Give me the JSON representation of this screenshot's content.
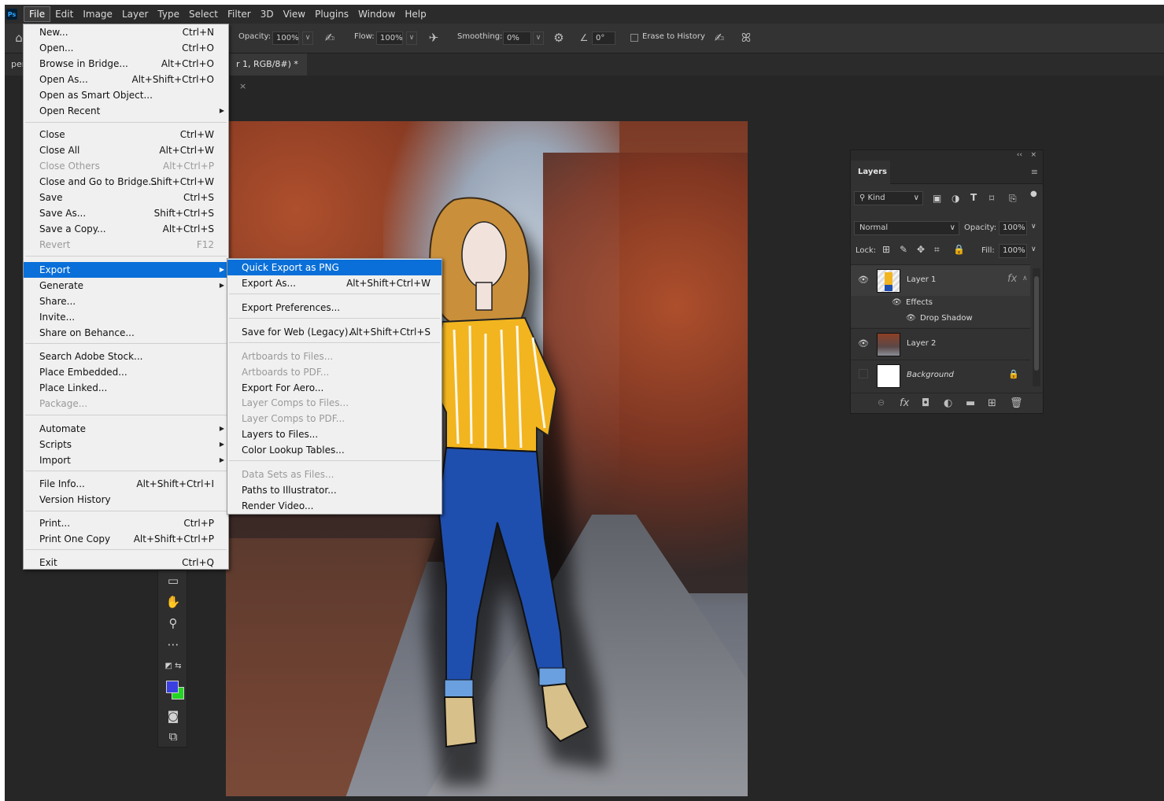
{
  "menubar": {
    "logo": "Ps",
    "items": [
      "File",
      "Edit",
      "Image",
      "Layer",
      "Type",
      "Select",
      "Filter",
      "3D",
      "View",
      "Plugins",
      "Window",
      "Help"
    ]
  },
  "options": {
    "opacity_label": "Opacity:",
    "opacity_value": "100%",
    "flow_label": "Flow:",
    "flow_value": "100%",
    "smoothing_label": "Smoothing:",
    "smoothing_value": "0%",
    "angle_value": "0°",
    "erase_label": "Erase to History"
  },
  "tabs": {
    "left_tab": "pen",
    "doc_tab": "r 1, RGB/8#) *",
    "close": "×"
  },
  "file_menu": [
    {
      "label": "New...",
      "shortcut": "Ctrl+N"
    },
    {
      "label": "Open...",
      "shortcut": "Ctrl+O"
    },
    {
      "label": "Browse in Bridge...",
      "shortcut": "Alt+Ctrl+O"
    },
    {
      "label": "Open As...",
      "shortcut": "Alt+Shift+Ctrl+O"
    },
    {
      "label": "Open as Smart Object...",
      "shortcut": ""
    },
    {
      "label": "Open Recent",
      "shortcut": ""
    },
    {
      "label": "Close",
      "shortcut": "Ctrl+W"
    },
    {
      "label": "Close All",
      "shortcut": "Alt+Ctrl+W"
    },
    {
      "label": "Close Others",
      "shortcut": "Alt+Ctrl+P"
    },
    {
      "label": "Close and Go to Bridge...",
      "shortcut": "Shift+Ctrl+W"
    },
    {
      "label": "Save",
      "shortcut": "Ctrl+S"
    },
    {
      "label": "Save As...",
      "shortcut": "Shift+Ctrl+S"
    },
    {
      "label": "Save a Copy...",
      "shortcut": "Alt+Ctrl+S"
    },
    {
      "label": "Revert",
      "shortcut": "F12"
    },
    {
      "label": "Export",
      "shortcut": ""
    },
    {
      "label": "Generate",
      "shortcut": ""
    },
    {
      "label": "Share...",
      "shortcut": ""
    },
    {
      "label": "Invite...",
      "shortcut": ""
    },
    {
      "label": "Share on Behance...",
      "shortcut": ""
    },
    {
      "label": "Search Adobe Stock...",
      "shortcut": ""
    },
    {
      "label": "Place Embedded...",
      "shortcut": ""
    },
    {
      "label": "Place Linked...",
      "shortcut": ""
    },
    {
      "label": "Package...",
      "shortcut": ""
    },
    {
      "label": "Automate",
      "shortcut": ""
    },
    {
      "label": "Scripts",
      "shortcut": ""
    },
    {
      "label": "Import",
      "shortcut": ""
    },
    {
      "label": "File Info...",
      "shortcut": "Alt+Shift+Ctrl+I"
    },
    {
      "label": "Version History",
      "shortcut": ""
    },
    {
      "label": "Print...",
      "shortcut": "Ctrl+P"
    },
    {
      "label": "Print One Copy",
      "shortcut": "Alt+Shift+Ctrl+P"
    },
    {
      "label": "Exit",
      "shortcut": "Ctrl+Q"
    }
  ],
  "export_menu": [
    {
      "label": "Quick Export as PNG",
      "shortcut": ""
    },
    {
      "label": "Export As...",
      "shortcut": "Alt+Shift+Ctrl+W"
    },
    {
      "label": "Export Preferences...",
      "shortcut": ""
    },
    {
      "label": "Save for Web (Legacy)...",
      "shortcut": "Alt+Shift+Ctrl+S"
    },
    {
      "label": "Artboards to Files...",
      "shortcut": ""
    },
    {
      "label": "Artboards to PDF...",
      "shortcut": ""
    },
    {
      "label": "Export For Aero...",
      "shortcut": ""
    },
    {
      "label": "Layer Comps to Files...",
      "shortcut": ""
    },
    {
      "label": "Layer Comps to PDF...",
      "shortcut": ""
    },
    {
      "label": "Layers to Files...",
      "shortcut": ""
    },
    {
      "label": "Color Lookup Tables...",
      "shortcut": ""
    },
    {
      "label": "Data Sets as Files...",
      "shortcut": ""
    },
    {
      "label": "Paths to Illustrator...",
      "shortcut": ""
    },
    {
      "label": "Render Video...",
      "shortcut": ""
    }
  ],
  "layers_panel": {
    "collapse": "‹‹",
    "close": "×",
    "tab_label": "Layers",
    "kind_label": "Kind",
    "blend_mode": "Normal",
    "opacity_label": "Opacity:",
    "opacity_value": "100%",
    "lock_label": "Lock:",
    "fill_label": "Fill:",
    "fill_value": "100%",
    "layers": [
      {
        "name": "Layer 1",
        "fx": "fx"
      },
      {
        "name": "Effects"
      },
      {
        "name": "Drop Shadow"
      },
      {
        "name": "Layer 2"
      },
      {
        "name": "Background"
      }
    ]
  },
  "colors": {
    "foreground": "#3b3fe0",
    "background": "#23d423",
    "menu_highlight": "#0a6fd8"
  }
}
